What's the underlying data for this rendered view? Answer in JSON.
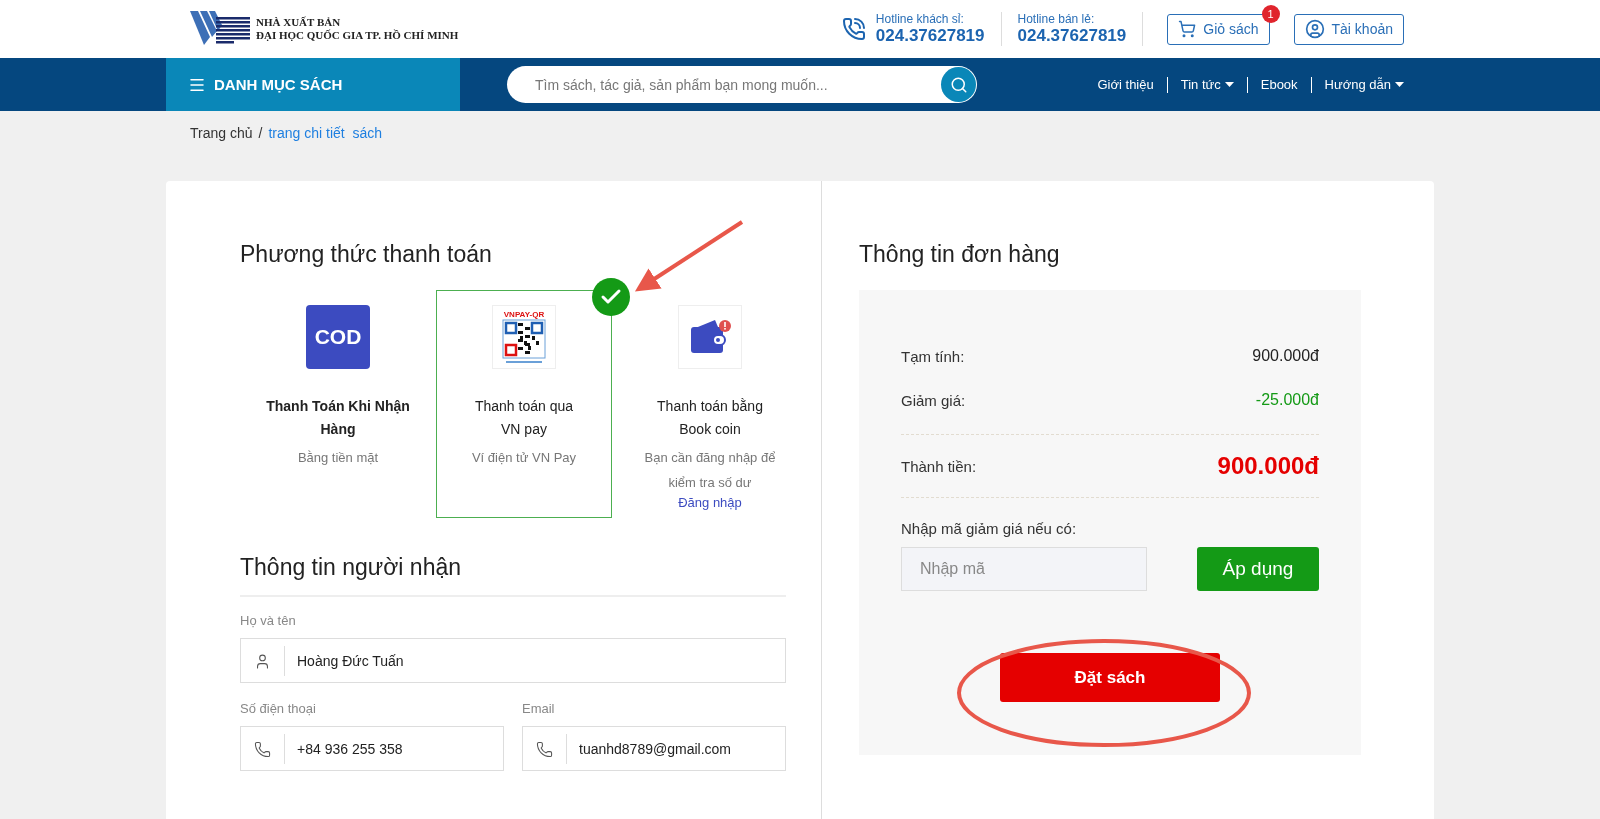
{
  "header": {
    "publisher": [
      "NHÀ XUẤT BẢN",
      "ĐẠI HỌC QUỐC GIA TP. HỒ CHÍ MINH"
    ],
    "hotlines": [
      {
        "label": "Hotline khách sỉ:",
        "number": "024.37627819"
      },
      {
        "label": "Hotline bán lẻ:",
        "number": "024.37627819"
      }
    ],
    "cart": {
      "label": "Giỏ sách",
      "count": "1"
    },
    "account": {
      "label": "Tài khoản"
    }
  },
  "navbar": {
    "category_menu": "DANH MỤC SÁCH",
    "search": {
      "placeholder": "Tìm sách, tác giả, sản phẩm bạn mong muốn..."
    },
    "links": [
      {
        "label": "Giới thiệu",
        "dropdown": false
      },
      {
        "label": "Tin tức",
        "dropdown": true
      },
      {
        "label": "Ebook",
        "dropdown": false
      },
      {
        "label": "Hướng dẫn",
        "dropdown": true
      }
    ]
  },
  "breadcrumb": {
    "separator": "/",
    "items": [
      {
        "label": "Trang chủ",
        "current": false
      },
      {
        "label": "trang chi tiết  sách",
        "current": true
      }
    ]
  },
  "payment": {
    "title": "Phương thức thanh toán",
    "methods": [
      {
        "kind": "cod",
        "logo": "COD",
        "name": "Thanh Toán Khi Nhận Hàng",
        "note": "Bằng tiền mặt",
        "selected": false
      },
      {
        "kind": "qr",
        "logo": "VNPAY-QR",
        "name": "Thanh toán qua VN pay",
        "note": "Ví điện tử VN Pay",
        "selected": true
      },
      {
        "kind": "wallet",
        "name": "Thanh toán bằng Book coin",
        "note": "Bạn cần đăng nhập để kiểm tra số dư",
        "link": "Đăng nhập",
        "selected": false
      }
    ]
  },
  "recipient": {
    "title": "Thông tin người nhận",
    "fields": [
      {
        "kind": "name",
        "label": "Họ và tên",
        "value": "Hoàng Đức Tuấn"
      },
      {
        "kind": "phone",
        "label": "Số điện thoại",
        "value": "+84 936 255 358"
      },
      {
        "kind": "email",
        "label": "Email",
        "value": "tuanhd8789@gmail.com"
      }
    ]
  },
  "order": {
    "title": "Thông tin đơn hàng",
    "lines": [
      {
        "kind": "plain",
        "label": "Tạm tính:",
        "value": "900.000đ"
      },
      {
        "kind": "discount",
        "label": "Giảm giá:",
        "value": "-25.000đ"
      },
      {
        "kind": "total",
        "label": "Thành tiền:",
        "value": "900.000đ"
      }
    ],
    "coupon": {
      "label": "Nhập mã giảm giá nếu có:",
      "placeholder": "Nhập mã",
      "button": "Áp dụng"
    },
    "submit": "Đặt sách"
  }
}
